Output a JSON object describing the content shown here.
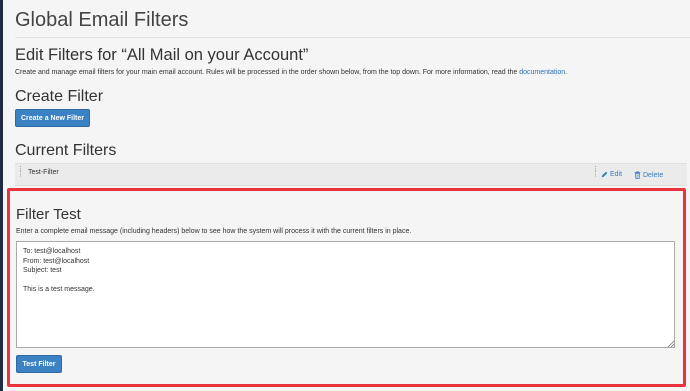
{
  "page": {
    "title": "Global Email Filters",
    "edit_heading": "Edit Filters for “All Mail on your Account”",
    "description_text": "Create and manage email filters for your main email account. Rules will be processed in the order shown below, from the top down. For more information, read the ",
    "description_link": "documentation",
    "description_end": "."
  },
  "create": {
    "heading": "Create Filter",
    "button_label": "Create a New Filter"
  },
  "current": {
    "heading": "Current Filters",
    "filters": [
      {
        "name": "Test-Filter",
        "edit_label": "Edit",
        "delete_label": "Delete"
      }
    ]
  },
  "filter_test": {
    "heading": "Filter Test",
    "description": "Enter a complete email message (including headers) below to see how the system will process it with the current filters in place.",
    "message": "To: test@localhost\nFrom: test@localhost\nSubject: test\n\nThis is a test message.",
    "button_label": "Test Filter"
  },
  "colors": {
    "accent": "#3a82c4",
    "highlight_border": "#e8343c",
    "link": "#2d6fb5"
  },
  "icons": [
    "drag-handle-icon",
    "pencil-icon",
    "trash-icon",
    "resize-grip-icon"
  ]
}
